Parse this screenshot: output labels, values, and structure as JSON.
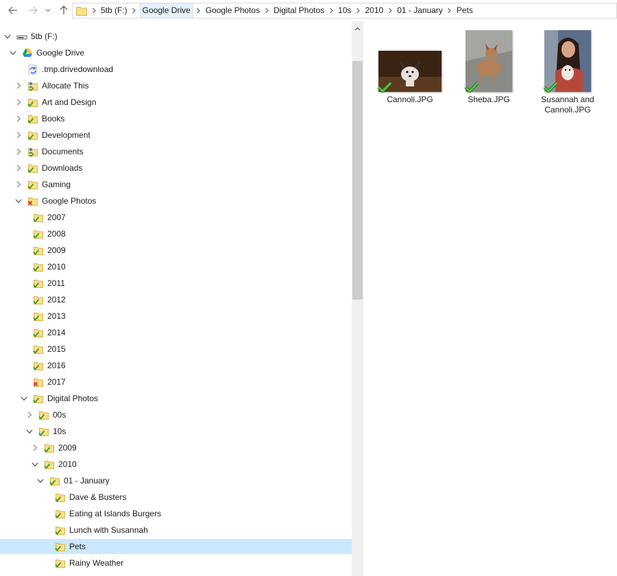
{
  "nav_buttons": {
    "back": "back-arrow-icon",
    "forward": "forward-arrow-icon",
    "recent": "chevron-down-icon",
    "up": "up-arrow-icon"
  },
  "breadcrumb": [
    "5tb (F:)",
    "Google Drive",
    "Google Photos",
    "Digital Photos",
    "10s",
    "2010",
    "01 - January",
    "Pets"
  ],
  "tree": [
    {
      "label": "5tb (F:)",
      "level": 0,
      "state": "expanded",
      "icon": "drive"
    },
    {
      "label": "Google Drive",
      "level": 1,
      "state": "expanded",
      "icon": "gdrive"
    },
    {
      "label": ".tmp.drivedownload",
      "level": 2,
      "state": "none",
      "icon": "sync"
    },
    {
      "label": "Allocate This",
      "level": 2,
      "state": "collapsed",
      "icon": "shared"
    },
    {
      "label": "Art and Design",
      "level": 2,
      "state": "collapsed",
      "icon": "check"
    },
    {
      "label": "Books",
      "level": 2,
      "state": "collapsed",
      "icon": "check"
    },
    {
      "label": "Development",
      "level": 2,
      "state": "collapsed",
      "icon": "check"
    },
    {
      "label": "Documents",
      "level": 2,
      "state": "collapsed",
      "icon": "shared"
    },
    {
      "label": "Downloads",
      "level": 2,
      "state": "collapsed",
      "icon": "check"
    },
    {
      "label": "Gaming",
      "level": 2,
      "state": "collapsed",
      "icon": "check"
    },
    {
      "label": "Google Photos",
      "level": 2,
      "state": "expanded",
      "icon": "error"
    },
    {
      "label": "2007",
      "level": 3,
      "state": "none",
      "icon": "check"
    },
    {
      "label": "2008",
      "level": 3,
      "state": "none",
      "icon": "check"
    },
    {
      "label": "2009",
      "level": 3,
      "state": "none",
      "icon": "check"
    },
    {
      "label": "2010",
      "level": 3,
      "state": "none",
      "icon": "check"
    },
    {
      "label": "2011",
      "level": 3,
      "state": "none",
      "icon": "check"
    },
    {
      "label": "2012",
      "level": 3,
      "state": "none",
      "icon": "check"
    },
    {
      "label": "2013",
      "level": 3,
      "state": "none",
      "icon": "check"
    },
    {
      "label": "2014",
      "level": 3,
      "state": "none",
      "icon": "check"
    },
    {
      "label": "2015",
      "level": 3,
      "state": "none",
      "icon": "check"
    },
    {
      "label": "2016",
      "level": 3,
      "state": "none",
      "icon": "check"
    },
    {
      "label": "2017",
      "level": 3,
      "state": "none",
      "icon": "error"
    },
    {
      "label": "Digital Photos",
      "level": 3,
      "state": "expanded",
      "icon": "check"
    },
    {
      "label": "00s",
      "level": 4,
      "state": "collapsed",
      "icon": "check"
    },
    {
      "label": "10s",
      "level": 4,
      "state": "expanded",
      "icon": "check"
    },
    {
      "label": "2009",
      "level": 5,
      "state": "collapsed",
      "icon": "check"
    },
    {
      "label": "2010",
      "level": 5,
      "state": "expanded",
      "icon": "check"
    },
    {
      "label": "01 - January",
      "level": 6,
      "state": "expanded",
      "icon": "check"
    },
    {
      "label": "Dave & Busters",
      "level": 7,
      "state": "none",
      "icon": "check"
    },
    {
      "label": "Eating at Islands Burgers",
      "level": 7,
      "state": "none",
      "icon": "check"
    },
    {
      "label": "Lunch with Susannah",
      "level": 7,
      "state": "none",
      "icon": "check"
    },
    {
      "label": "Pets",
      "level": 7,
      "state": "none",
      "icon": "check",
      "selected": true
    },
    {
      "label": "Rainy Weather",
      "level": 7,
      "state": "none",
      "icon": "check"
    }
  ],
  "files": [
    {
      "name": "Cannoli.JPG",
      "thumb": "dog-photo-thumbnail",
      "status": "synced-check-icon"
    },
    {
      "name": "Sheba.JPG",
      "thumb": "dog-photo-thumbnail",
      "status": "synced-check-icon"
    },
    {
      "name": "Susannah and Cannoli.JPG",
      "thumb": "person-with-dog-photo-thumbnail",
      "status": "synced-check-icon"
    }
  ],
  "colors": {
    "selection": "#cce8ff",
    "breadcrumb_hot": "#e5f1fb",
    "folder": "#f8d775",
    "sync_check": "#3aa63a",
    "sync_error": "#e02020",
    "scroll_thumb": "#cdcdcd"
  }
}
